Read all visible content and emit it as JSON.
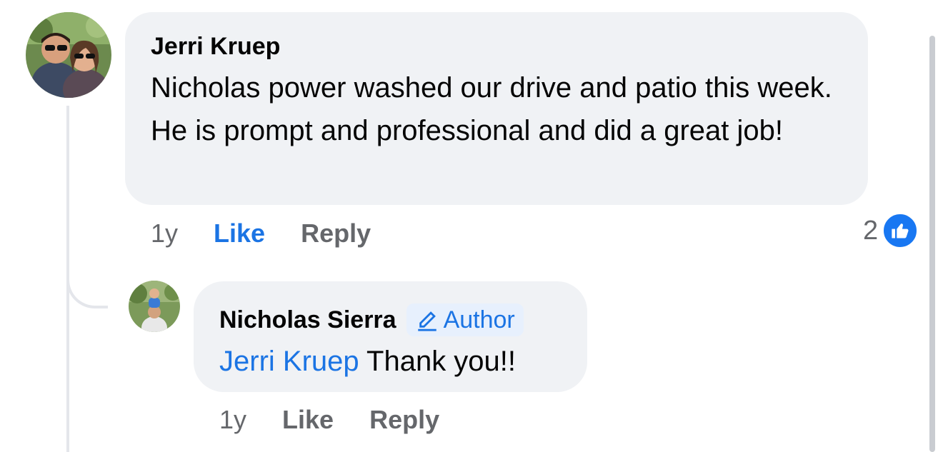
{
  "colors": {
    "bubble_bg": "#f0f2f5",
    "link_blue": "#1b74e4",
    "secondary_text": "#65676b",
    "badge_bg": "#e7f0fd",
    "like_badge": "#1877f2"
  },
  "comment": {
    "author": "Jerri Kruep",
    "text": "Nicholas power washed our drive and patio this week. He is prompt and professional and did a great job!",
    "time": "1y",
    "like_label": "Like",
    "reply_label": "Reply",
    "liked": true,
    "reaction_count": "2",
    "reaction_icon": "thumbs-up-icon"
  },
  "reply": {
    "author": "Nicholas Sierra",
    "badge_label": "Author",
    "badge_icon": "pencil-icon",
    "mention": "Jerri Kruep",
    "text": "Thank you!!",
    "time": "1y",
    "like_label": "Like",
    "reply_label": "Reply"
  }
}
